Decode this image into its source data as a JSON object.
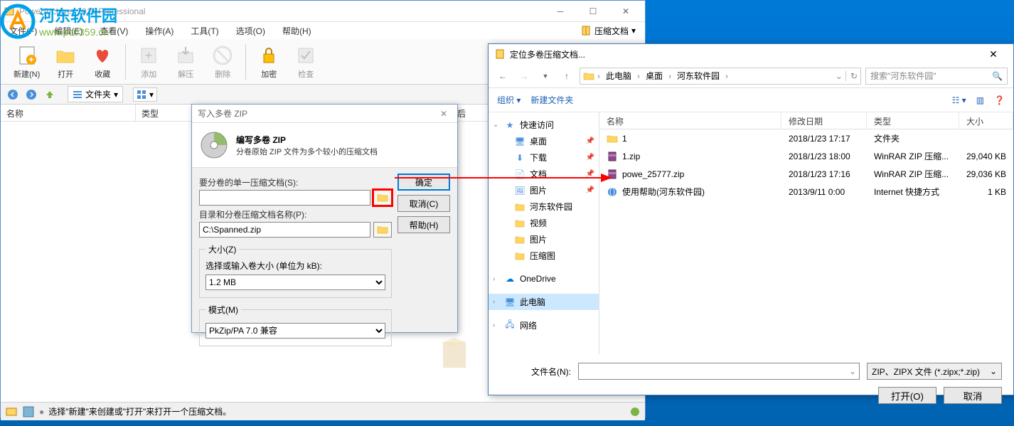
{
  "mainWindow": {
    "title": "PowerArchiver 2015 Professional",
    "menus": [
      "文件(F)",
      "编辑(E)",
      "查看(V)",
      "操作(A)",
      "工具(T)",
      "选项(O)",
      "帮助(H)"
    ],
    "archiveDropdown": "压缩文档",
    "toolbar": {
      "new": "新建(N)",
      "open": "打开",
      "fav": "收藏",
      "add": "添加",
      "extract": "解压",
      "delete": "删除",
      "encrypt": "加密",
      "check": "检查"
    },
    "folderDropdown": "文件夹",
    "columns": {
      "name": "名称",
      "type": "类型",
      "after": "包后"
    },
    "status": "选择\"新建\"来创建或\"打开\"来打开一个压缩文档。"
  },
  "watermark": {
    "text1": "河东软件园",
    "text2": "www.pc0359.cn"
  },
  "zipDialog": {
    "title": "写入多卷 ZIP",
    "header": "编写多卷 ZIP",
    "subheader": "分卷原始 ZIP 文件为多个较小的压缩文档",
    "label1": "要分卷的单一压缩文档(S):",
    "label2": "目录和分卷压缩文档名称(P):",
    "value2": "C:\\Spanned.zip",
    "sizeLegend": "大小(Z)",
    "sizeDesc": "选择或输入卷大小 (单位为 kB):",
    "sizeValue": "1.2 MB",
    "modeLegend": "模式(M)",
    "modeValue": "PkZip/PA 7.0 兼容",
    "btnOk": "确定",
    "btnCancel": "取消(C)",
    "btnHelp": "帮助(H)"
  },
  "fileDialog": {
    "title": "定位多卷压缩文档...",
    "breadcrumb": [
      "此电脑",
      "桌面",
      "河东软件园"
    ],
    "searchPlaceholder": "搜索\"河东软件园\"",
    "organize": "组织",
    "newFolder": "新建文件夹",
    "tree": {
      "quickAccess": "快速访问",
      "desktop": "桌面",
      "downloads": "下载",
      "documents": "文档",
      "pictures": "图片",
      "hedong": "河东软件园",
      "video": "视频",
      "pictures2": "图片",
      "compressed": "压缩图",
      "onedrive": "OneDrive",
      "thisPC": "此电脑",
      "network": "网络"
    },
    "columns": {
      "name": "名称",
      "date": "修改日期",
      "type": "类型",
      "size": "大小"
    },
    "files": [
      {
        "name": "1",
        "date": "2018/1/23 17:17",
        "type": "文件夹",
        "size": "",
        "icon": "folder"
      },
      {
        "name": "1.zip",
        "date": "2018/1/23 18:00",
        "type": "WinRAR ZIP 压缩...",
        "size": "29,040 KB",
        "icon": "zip"
      },
      {
        "name": "powe_25777.zip",
        "date": "2018/1/23 17:16",
        "type": "WinRAR ZIP 压缩...",
        "size": "29,036 KB",
        "icon": "zip"
      },
      {
        "name": "使用帮助(河东软件园)",
        "date": "2013/9/11 0:00",
        "type": "Internet 快捷方式",
        "size": "1 KB",
        "icon": "url"
      }
    ],
    "filenameLabel": "文件名(N):",
    "fileType": "ZIP、ZIPX 文件 (*.zipx;*.zip)",
    "btnOpen": "打开(O)",
    "btnCancel": "取消"
  }
}
